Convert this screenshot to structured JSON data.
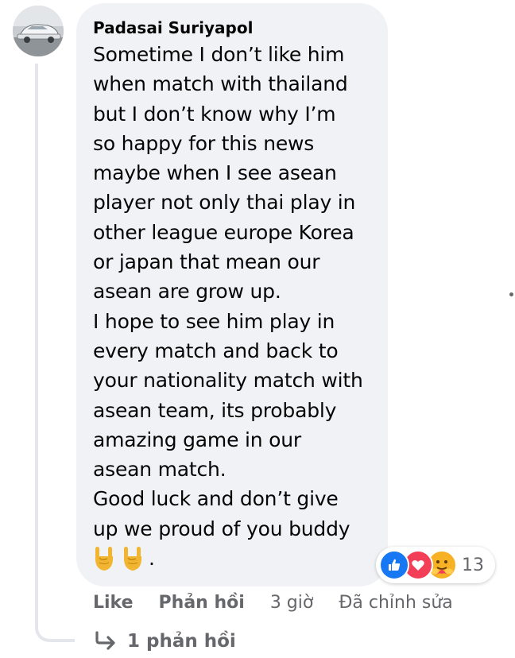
{
  "comment": {
    "author": "Padasai Suriyapol",
    "lines": [
      "Sometime I don’t like him",
      "when match with thailand",
      "but I don’t know why I’m",
      "so happy for this news",
      "maybe when I see asean",
      "player not only thai play in",
      "other league europe Korea",
      "or japan that mean our",
      "asean are grow up.",
      "I hope to see him play in",
      "every match and back to",
      "your nationality match with",
      "asean team, its probably",
      "amazing game in our",
      "asean match.",
      "Good luck and don’t give",
      "up we proud of you buddy"
    ],
    "trailing_emoji": [
      "sign-of-the-horns-icon",
      "sign-of-the-horns-icon"
    ],
    "trailing_text": "."
  },
  "reactions": {
    "icons": [
      "like-reaction-icon",
      "love-reaction-icon",
      "care-reaction-icon"
    ],
    "count": "13"
  },
  "actions": {
    "like": "Like",
    "reply": "Phản hồi",
    "time": "3 giờ",
    "edited": "Đã chỉnh sửa"
  },
  "replies": {
    "label": "1 phản hồi",
    "icon": "reply-arrow-icon"
  },
  "colors": {
    "bubble": "#f0f2f5",
    "text": "#050505",
    "secondary": "#65676b",
    "like_blue": "#1877f2",
    "love_red": "#f33e58",
    "care_yellow": "#f7b125"
  }
}
